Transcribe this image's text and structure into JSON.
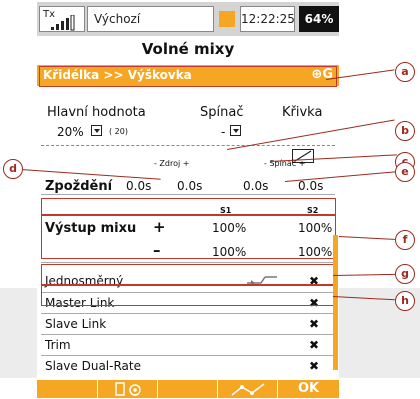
{
  "status_bar": {
    "tx_label": "Tx",
    "model_name": "Výchozí",
    "clock": "12:22:25",
    "battery": "64%"
  },
  "page_title": "Volné mixy",
  "mix_header": {
    "name": "Křidélka >> Výškovka",
    "icons": "⊕G"
  },
  "params": {
    "master_value_label": "Hlavní hodnota",
    "switch_label": "Spínač",
    "curve_label": "Křivka",
    "master_value": "20%",
    "master_value_paren": "( 20)",
    "switch_value": "-"
  },
  "delay": {
    "label": "Zpoždění",
    "source_header": "- Zdroj +",
    "switch_header": "- Spínač +",
    "source_minus": "0.0s",
    "source_plus": "0.0s",
    "switch_minus": "0.0s",
    "switch_plus": "0.0s"
  },
  "output": {
    "col_s1": "S1",
    "col_s2": "S2",
    "label": "Výstup mixu",
    "plus_sign": "+",
    "minus_sign": "–",
    "plus_s1": "100%",
    "plus_s2": "100%",
    "minus_s1": "100%",
    "minus_s2": "100%"
  },
  "options": [
    {
      "label": "Jednosměrný",
      "value": "✖"
    },
    {
      "label": "Master Link",
      "value": "✖"
    },
    {
      "label": "Slave Link",
      "value": "✖"
    },
    {
      "label": "Trim",
      "value": "✖"
    },
    {
      "label": "Slave Dual-Rate",
      "value": "✖"
    }
  ],
  "bottom_bar": {
    "ok_label": "OK"
  },
  "callouts": [
    "a",
    "b",
    "c",
    "d",
    "e",
    "f",
    "g",
    "h"
  ]
}
